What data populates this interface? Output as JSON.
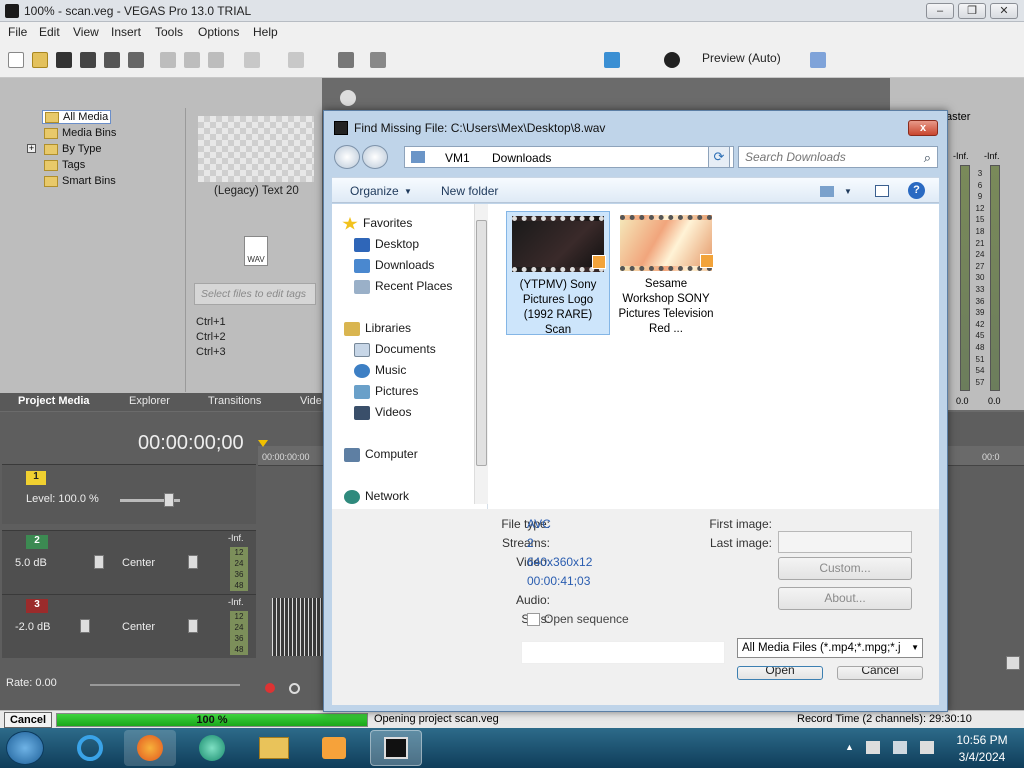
{
  "app": {
    "title": "100% - scan.veg - VEGAS Pro 13.0 TRIAL",
    "menu": [
      "File",
      "Edit",
      "View",
      "Insert",
      "Tools",
      "Options",
      "Help"
    ],
    "preview_label": "Preview (Auto)",
    "master_label": "aster"
  },
  "media": {
    "tree": [
      "All Media",
      "Media Bins",
      "By Type",
      "Tags",
      "Smart Bins"
    ],
    "item_label": "(Legacy) Text 20",
    "wav_label": "WAV",
    "tags_placeholder": "Select files to edit tags",
    "shortcuts": [
      "Ctrl+1",
      "Ctrl+2",
      "Ctrl+3"
    ],
    "tabs": [
      "Project Media",
      "Explorer",
      "Transitions",
      "Vide"
    ]
  },
  "meter": {
    "inf_left": "-Inf.",
    "inf_right": "-Inf.",
    "scale": [
      "3",
      "6",
      "9",
      "12",
      "15",
      "18",
      "21",
      "24",
      "27",
      "30",
      "33",
      "36",
      "39",
      "42",
      "45",
      "48",
      "51",
      "54",
      "57"
    ],
    "bottom_left": "0.0",
    "bottom_right": "0.0"
  },
  "timeline": {
    "timecode": "00:00:00;00",
    "ruler_start": "00:00:00:00",
    "ruler_right": "00:0",
    "track1": {
      "number": "1",
      "level": "Level: 100.0 %"
    },
    "track2": {
      "number": "2",
      "volume": "5.0 dB",
      "pan": "Center",
      "inf": "-Inf."
    },
    "track3": {
      "number": "3",
      "volume": "-2.0 dB",
      "pan": "Center",
      "inf": "-Inf."
    },
    "mini_scale": [
      "12",
      "24",
      "36",
      "48"
    ],
    "rate": "Rate: 0.00"
  },
  "status": {
    "cancel": "Cancel",
    "progress_text": "100 %",
    "progress_fraction": 1.0,
    "message": "Opening project scan.veg",
    "record_time": "Record Time (2 channels): 29:30:10"
  },
  "dialog": {
    "title": "Find Missing File: C:\\Users\\Mex\\Desktop\\8.wav",
    "close": "x",
    "address": {
      "crumb1": "VM1",
      "crumb2": "Downloads"
    },
    "search_placeholder": "Search Downloads",
    "commands": {
      "organize": "Organize",
      "new_folder": "New folder"
    },
    "nav": {
      "favorites": "Favorites",
      "desktop": "Desktop",
      "downloads": "Downloads",
      "recent": "Recent Places",
      "libraries": "Libraries",
      "documents": "Documents",
      "music": "Music",
      "pictures": "Pictures",
      "videos": "Videos",
      "computer": "Computer",
      "network": "Network"
    },
    "files": [
      {
        "name": "(YTPMV) Sony Pictures Logo (1992 RARE) Scan",
        "selected": true
      },
      {
        "name": "Sesame Workshop SONY Pictures Television Red ...",
        "selected": false
      }
    ],
    "info": {
      "file_type_label": "File type:",
      "file_type": "AVC",
      "streams_label": "Streams:",
      "streams": "2",
      "video_label": "Video:",
      "video_res": "640x360x12",
      "video_dur": "00:00:41;03",
      "audio_label": "Audio:",
      "stills_label": "Stills:",
      "open_sequence": "Open sequence",
      "first_image_label": "First image:",
      "last_image_label": "Last image:",
      "custom": "Custom...",
      "about": "About..."
    },
    "filter": "All Media Files (*.mp4;*.mpg;*.j",
    "open": "Open",
    "cancel": "Cancel"
  },
  "taskbar": {
    "time": "10:56 PM",
    "date": "3/4/2024"
  }
}
